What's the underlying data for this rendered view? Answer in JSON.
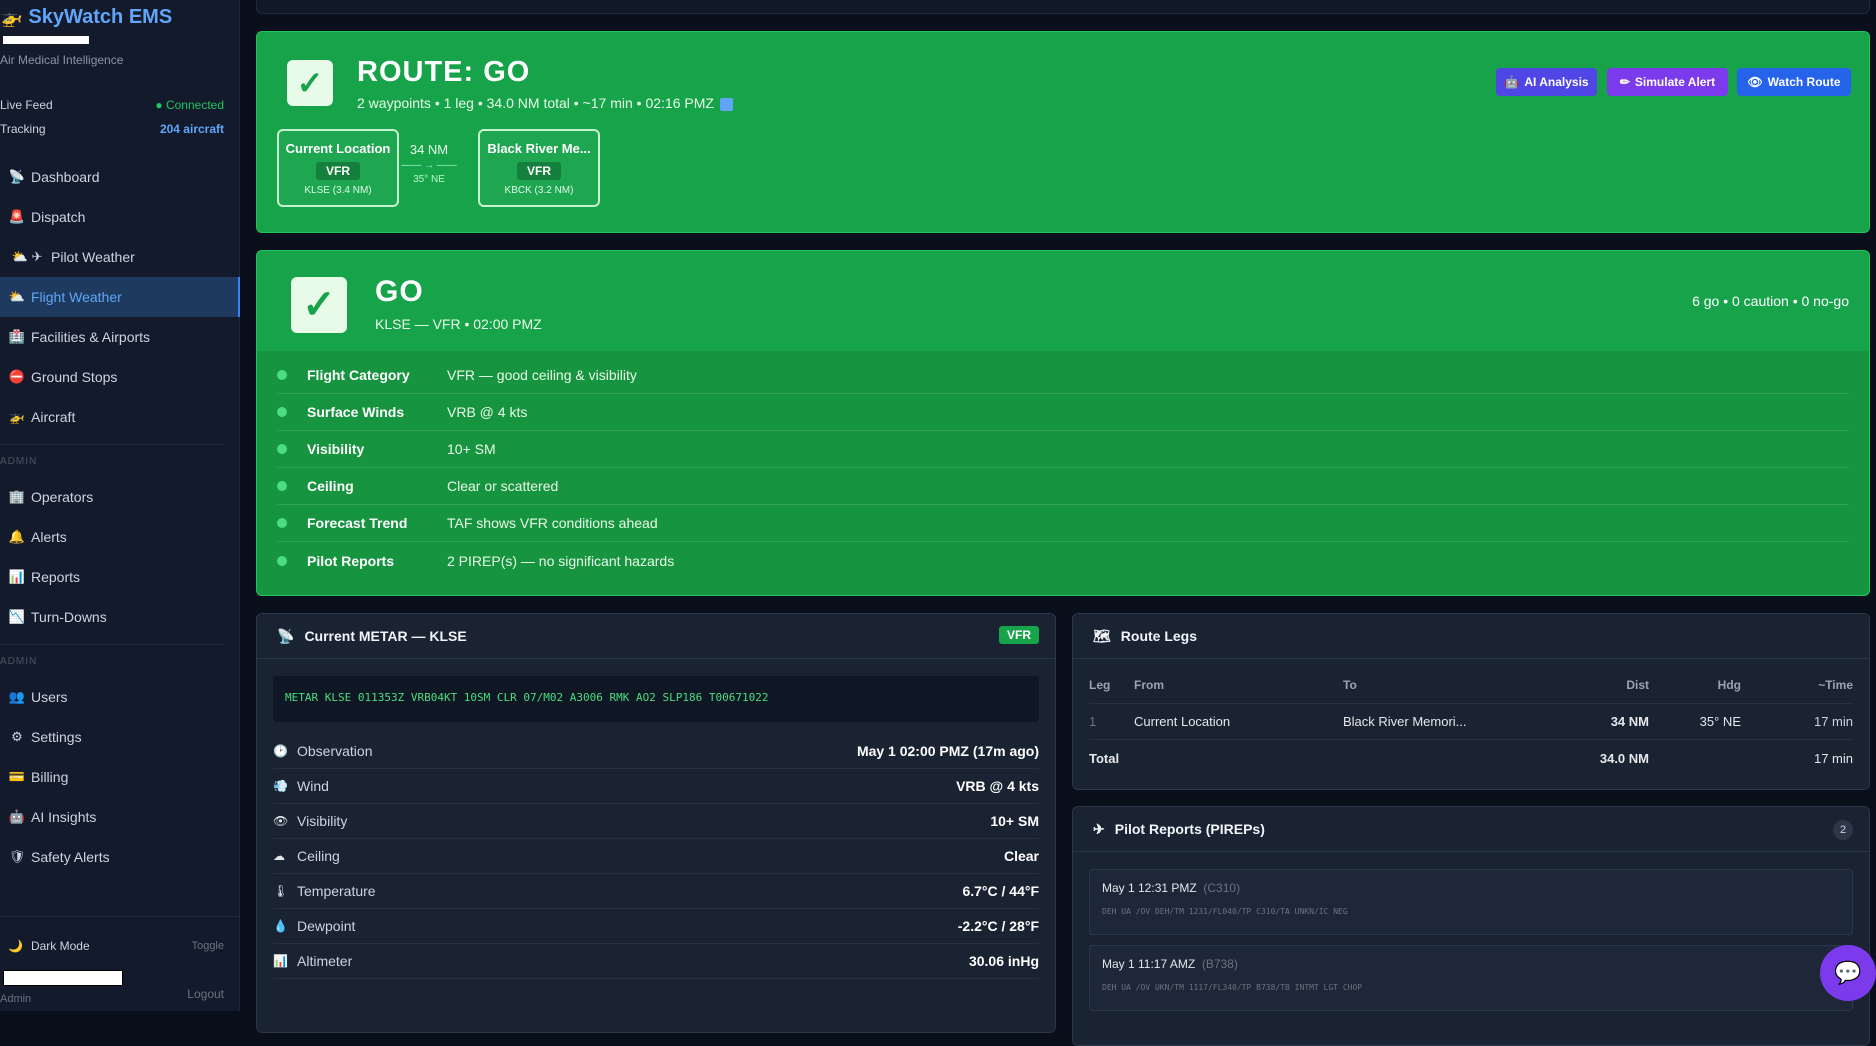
{
  "sidebar": {
    "brand": "SkyWatch EMS",
    "tagline": "Air Medical Intelligence",
    "live_feed_label": "Live Feed",
    "live_feed_value": "Connected",
    "tracking_label": "Tracking",
    "tracking_value": "204 aircraft",
    "items": [
      {
        "label": "Dashboard"
      },
      {
        "label": "Dispatch"
      },
      {
        "label": "Pilot Weather"
      },
      {
        "label": "Flight Weather"
      },
      {
        "label": "Facilities & Airports"
      },
      {
        "label": "Ground Stops"
      },
      {
        "label": "Aircraft"
      }
    ],
    "section1": "ADMIN",
    "items2": [
      {
        "label": "Operators"
      },
      {
        "label": "Alerts"
      },
      {
        "label": "Reports"
      },
      {
        "label": "Turn-Downs"
      }
    ],
    "section2": "ADMIN",
    "items3": [
      {
        "label": "Users"
      },
      {
        "label": "Settings"
      },
      {
        "label": "Billing"
      },
      {
        "label": "AI Insights"
      },
      {
        "label": "Safety Alerts"
      }
    ],
    "dark_mode_label": "Dark Mode",
    "toggle_label": "Toggle",
    "role_label": "Admin",
    "logout_label": "Logout"
  },
  "route": {
    "title": "ROUTE: GO",
    "subtitle": "2 waypoints • 1 leg • 34.0 NM total • ~17 min • 02:16 PMZ",
    "waypoints": [
      {
        "name": "Current Location",
        "category": "VFR",
        "code": "KLSE (3.4 NM)"
      },
      {
        "name": "Black River Me...",
        "category": "VFR",
        "code": "KBCK (3.2 NM)"
      }
    ],
    "leg_distance": "34 NM",
    "leg_arrow": "—— → ——",
    "leg_heading": "35° NE",
    "buttons": {
      "ai_analysis": "AI Analysis",
      "simulate_alert": "Simulate Alert",
      "watch_route": "Watch Route"
    }
  },
  "go": {
    "title": "GO",
    "subtitle": "KLSE — VFR • 02:00 PMZ",
    "counts": "6 go • 0 caution • 0 no-go",
    "criteria": [
      {
        "label": "Flight Category",
        "value": "VFR — good ceiling & visibility"
      },
      {
        "label": "Surface Winds",
        "value": "VRB @ 4 kts"
      },
      {
        "label": "Visibility",
        "value": "10+ SM"
      },
      {
        "label": "Ceiling",
        "value": "Clear or scattered"
      },
      {
        "label": "Forecast Trend",
        "value": "TAF shows VFR conditions ahead"
      },
      {
        "label": "Pilot Reports",
        "value": "2 PIREP(s) — no significant hazards"
      }
    ]
  },
  "metar": {
    "title": "Current METAR — KLSE",
    "badge": "VFR",
    "raw": "METAR KLSE 011353Z VRB04KT 10SM CLR 07/M02 A3006 RMK AO2 SLP186 T00671022",
    "rows": [
      {
        "icon": "clock-icon",
        "label": "Observation",
        "value": "May 1 02:00 PMZ (17m ago)"
      },
      {
        "icon": "wind-icon",
        "label": "Wind",
        "value": "VRB @ 4 kts"
      },
      {
        "icon": "eye-icon",
        "label": "Visibility",
        "value": "10+ SM"
      },
      {
        "icon": "cloud-icon",
        "label": "Ceiling",
        "value": "Clear"
      },
      {
        "icon": "thermometer-icon",
        "label": "Temperature",
        "value": "6.7°C / 44°F"
      },
      {
        "icon": "droplet-icon",
        "label": "Dewpoint",
        "value": "-2.2°C / 28°F"
      },
      {
        "icon": "chart-icon",
        "label": "Altimeter",
        "value": "30.06 inHg"
      }
    ]
  },
  "legs": {
    "title": "Route Legs",
    "headers": [
      "Leg",
      "From",
      "To",
      "Dist",
      "Hdg",
      "~Time"
    ],
    "rows": [
      {
        "leg": "1",
        "from": "Current Location",
        "to": "Black River Memori...",
        "dist": "34 NM",
        "hdg": "35° NE",
        "time": "17 min"
      }
    ],
    "total_label": "Total",
    "total_dist": "34.0 NM",
    "total_time": "17 min"
  },
  "pireps": {
    "title": "Pilot Reports (PIREPs)",
    "count": "2",
    "items": [
      {
        "time": "May 1 12:31 PMZ",
        "type": "(C310)",
        "raw": "DEH UA /OV DEH/TM 1231/FL040/TP C310/TA UNKN/IC NEG"
      },
      {
        "time": "May 1 11:17 AMZ",
        "type": "(B738)",
        "raw": "DEH UA /OV UKN/TM 1117/FL340/TP B738/TB INTMT LGT CHOP"
      }
    ]
  },
  "colors": {
    "go_green": "#16a34a",
    "accent_blue": "#3b82f6",
    "purple": "#7c3aed"
  }
}
